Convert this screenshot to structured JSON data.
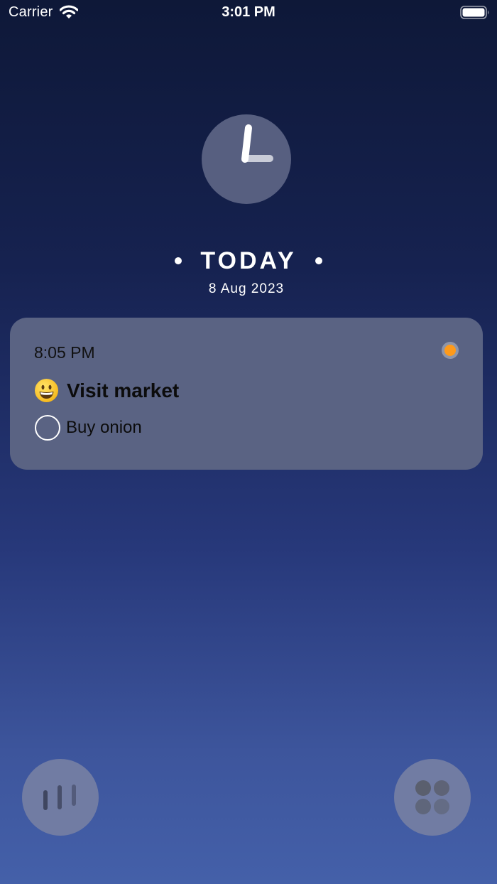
{
  "status_bar": {
    "carrier": "Carrier",
    "time": "3:01 PM",
    "wifi_icon": "wifi-icon",
    "battery_icon": "battery-icon"
  },
  "header": {
    "clock_icon": "clock-icon",
    "title": "TODAY",
    "date": "8 Aug 2023"
  },
  "task": {
    "time": "8:05 PM",
    "emoji_icon": "grinning-face-icon",
    "title": "Visit market",
    "status_color": "#ff9a1a",
    "subtasks": [
      {
        "label": "Buy onion",
        "checked": false
      }
    ]
  },
  "bottom_bar": {
    "left_button_icon": "bars-icon",
    "right_button_icon": "grid-dots-icon"
  },
  "colors": {
    "background_top": "#0e1838",
    "background_bottom": "#4460a9",
    "card": "#5a6383",
    "fab": "#717ca3"
  }
}
